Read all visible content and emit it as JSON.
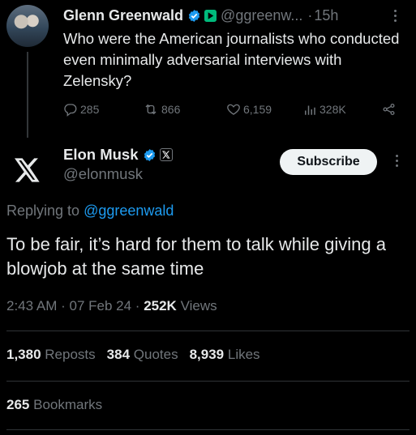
{
  "parent_tweet": {
    "author_name": "Glenn Greenwald",
    "handle": "@ggreenw...",
    "separator": "·",
    "time": "15h",
    "text": "Who were the American journalists who conducted even minimally adversarial interviews with Zelensky?",
    "actions": {
      "replies": "285",
      "reposts": "866",
      "likes": "6,159",
      "views": "328K"
    }
  },
  "main_tweet": {
    "author_name": "Elon Musk",
    "handle": "@elonmusk",
    "subscribe_label": "Subscribe",
    "replying_prefix": "Replying to",
    "replying_mention": "@ggreenwald",
    "text": "To be fair, it’s hard for them to talk while giving a blowjob at the same time",
    "time": "2:43 AM",
    "date": "07 Feb 24",
    "views_count": "252K",
    "views_label": "Views",
    "stats": {
      "reposts_count": "1,380",
      "reposts_label": "Reposts",
      "quotes_count": "384",
      "quotes_label": "Quotes",
      "likes_count": "8,939",
      "likes_label": "Likes",
      "bookmarks_count": "265",
      "bookmarks_label": "Bookmarks"
    }
  },
  "icons": {
    "verified": "verified-badge-icon",
    "reply": "reply-icon",
    "repost": "repost-icon",
    "like": "heart-icon",
    "views": "views-icon",
    "share": "share-icon",
    "x_logo": "x-logo-icon",
    "more": "more-vertical-icon"
  },
  "colors": {
    "background": "#000000",
    "text": "#e7e9ea",
    "muted": "#71767b",
    "accent": "#1d9bf0",
    "divider": "#2f3336"
  }
}
